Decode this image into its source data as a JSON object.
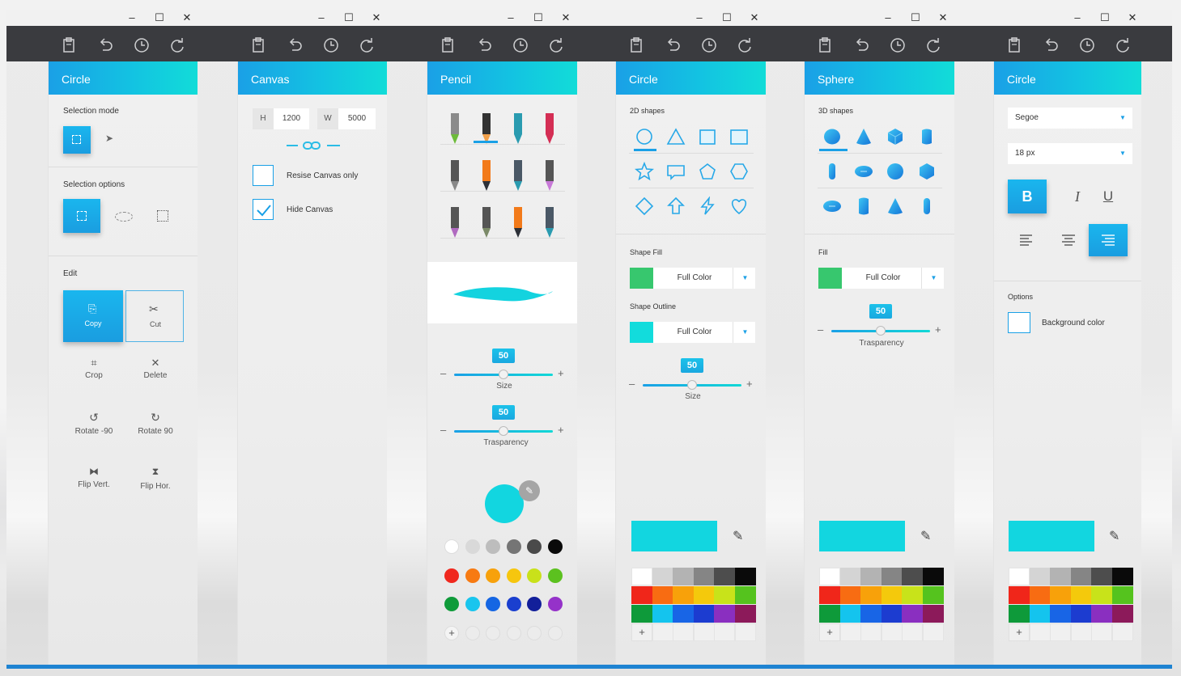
{
  "toolbar": {
    "icons": [
      "clipboard-icon",
      "undo-icon",
      "history-icon",
      "redo-icon"
    ]
  },
  "window_controls": {
    "minimize": "–",
    "maximize": "☐",
    "close": "✕"
  },
  "colors": {
    "accent": "#1aa0e6",
    "accent_light": "#12dcd8",
    "toolbar_bg": "#3a3b3f",
    "cyan": "#12d6e0"
  },
  "panel1": {
    "title": "Circle",
    "selection_mode": "Selection mode",
    "selection_options": "Selection options",
    "edit": "Edit",
    "copy": "Copy",
    "cut": "Cut",
    "crop": "Crop",
    "delete": "Delete",
    "rotate_neg": "Rotate -90",
    "rotate_pos": "Rotate 90",
    "flip_vert": "Flip Vert.",
    "flip_hor": "Flip Hor."
  },
  "panel2": {
    "title": "Canvas",
    "h_label": "H",
    "h_value": "1200",
    "w_label": "W",
    "w_value": "5000",
    "resize_only": "Resise Canvas only",
    "hide_canvas": "Hide Canvas",
    "resize_checked": false,
    "hide_checked": true
  },
  "panel3": {
    "title": "Pencil",
    "size_value": "50",
    "size_label": "Size",
    "transparency_value": "50",
    "transparency_label": "Trasparency",
    "palette_rows": [
      [
        "#ffffff",
        "#d9d9d9",
        "#bdbdbd",
        "#757575",
        "#4a4a4a",
        "#0a0a0a"
      ],
      [
        "#f0281e",
        "#f77a12",
        "#f7a10c",
        "#f6c60e",
        "#c9e11a",
        "#5cc11f"
      ],
      [
        "#0f9b3a",
        "#19c5ee",
        "#1566e3",
        "#1a3fcf",
        "#121f9a",
        "#9532c9"
      ],
      [
        "+",
        "#ececec",
        "#ececec",
        "#ececec",
        "#ececec",
        "#ececec"
      ]
    ]
  },
  "panel4": {
    "title": "Circle",
    "shapes_label": "2D shapes",
    "shape_fill": "Shape Fill",
    "fill_value": "Full Color",
    "shape_outline": "Shape Outline",
    "outline_value": "Full Color",
    "size_value": "50",
    "size_label": "Size"
  },
  "panel5": {
    "title": "Sphere",
    "shapes_label": "3D shapes",
    "fill": "Fill",
    "fill_value": "Full Color",
    "transparency_value": "50",
    "transparency_label": "Trasparency"
  },
  "panel6": {
    "title": "Circle",
    "font": "Segoe",
    "font_size": "18 px",
    "bold": "B",
    "italic": "I",
    "underline": "U",
    "options": "Options",
    "background_color": "Background color"
  },
  "grid_palette": [
    [
      "#ffffff",
      "#d4d4d4",
      "#b3b3b3",
      "#858585",
      "#4d4d4d",
      "#0a0a0a"
    ],
    [
      "#f0261a",
      "#f86c12",
      "#f8a10a",
      "#f4c90c",
      "#c8e31a",
      "#55c31e"
    ],
    [
      "#0e9a3a",
      "#14c4ee",
      "#1865e6",
      "#1c3cd0",
      "#8a2fc0",
      "#8c1a5a"
    ],
    [
      "+",
      "#f0f0f0",
      "#f0f0f0",
      "#f0f0f0",
      "#f0f0f0",
      "#f0f0f0"
    ]
  ]
}
